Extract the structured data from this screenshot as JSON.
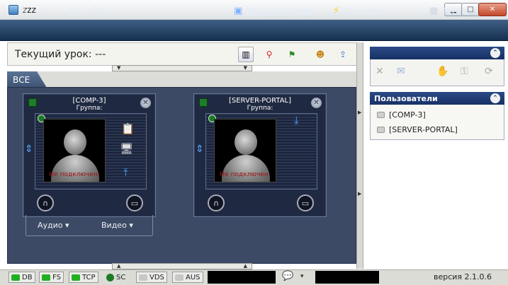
{
  "window": {
    "title": "zzz"
  },
  "toolbar": {
    "nav": [
      {
        "label": "Мультимедиа",
        "icon": "multimedia-icon"
      },
      {
        "label": "Лингафон",
        "icon": "lightning-icon"
      },
      {
        "label": "Тесты",
        "icon": "tests-icon"
      }
    ]
  },
  "lesson": {
    "label": "Текущий урок:",
    "value": "---"
  },
  "tabs": [
    {
      "label": "ВСЕ"
    }
  ],
  "cards": [
    {
      "name": "[COMP-3]",
      "group": "Группа:",
      "status": "Не подключен."
    },
    {
      "name": "[SERVER-PORTAL]",
      "group": "Группа:",
      "status": "Не подключен."
    }
  ],
  "media": {
    "audio": "Аудио",
    "video": "Видео"
  },
  "users_panel": {
    "title": "Пользователи",
    "items": [
      "[COMP-3]",
      "[SERVER-PORTAL]"
    ]
  },
  "statusbar": {
    "items": [
      {
        "label": "DB",
        "color": "#22b022"
      },
      {
        "label": "FS",
        "color": "#22b022"
      },
      {
        "label": "TCP",
        "color": "#22b022"
      },
      {
        "label": "SC",
        "color": "#1c7a25"
      },
      {
        "label": "VDS",
        "color": "#c8c8c8"
      },
      {
        "label": "AUS",
        "color": "#c8c8c8"
      }
    ],
    "version": "версия 2.1.0.6"
  }
}
